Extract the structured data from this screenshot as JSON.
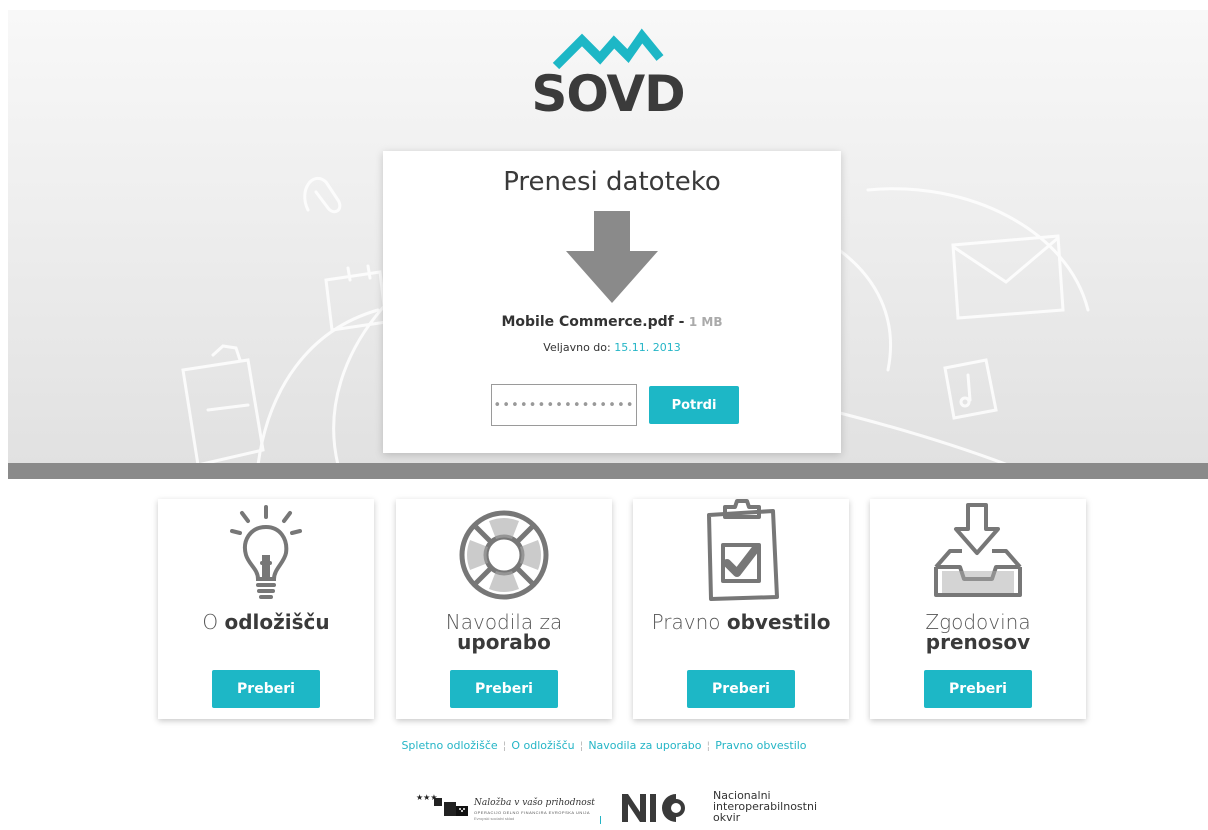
{
  "logo": {
    "text": "SOVD",
    "icon": "mountains-logo"
  },
  "upload": {
    "title": "Prenesi datoteko",
    "file_name": "Mobile Commerce.pdf -",
    "file_size": "1 MB",
    "valid_label": "Veljavno do:",
    "valid_date": "15.11. 2013",
    "password_value": "••••••••••••••••",
    "confirm_label": "Potrdi",
    "arrow_icon": "download-arrow-icon"
  },
  "features": [
    {
      "title_light": "O ",
      "title_bold": "odložišču",
      "button": "Preberi",
      "icon": "lightbulb-icon"
    },
    {
      "title_light": "Navodila za",
      "title_bold": "uporabo",
      "button": "Preberi",
      "icon": "lifebuoy-icon"
    },
    {
      "title_light": "Pravno ",
      "title_bold": "obvestilo",
      "button": "Preberi",
      "icon": "clipboard-check-icon"
    },
    {
      "title_light": "Zgodovina",
      "title_bold": "prenosov",
      "button": "Preberi",
      "icon": "inbox-download-icon"
    }
  ],
  "footer": {
    "links": [
      "Spletno odložišče",
      "O odložišču",
      "Navodila za uporabo",
      "Pravno obvestilo"
    ]
  },
  "partners": {
    "eu_slogan": "Naložba v vašo prihodnost",
    "eu_subtitle": "OPERACIJO DELNO FINANCIRA EVROPSKA UNIJA",
    "eu_fund": "Evropski socialni sklad",
    "nio_lines": [
      "Nacionalni",
      "interoperabilnostni",
      "okvir"
    ]
  },
  "colors": {
    "accent": "#1db7c6",
    "dark": "#3b3b3b",
    "bar": "#8a8a8a"
  }
}
